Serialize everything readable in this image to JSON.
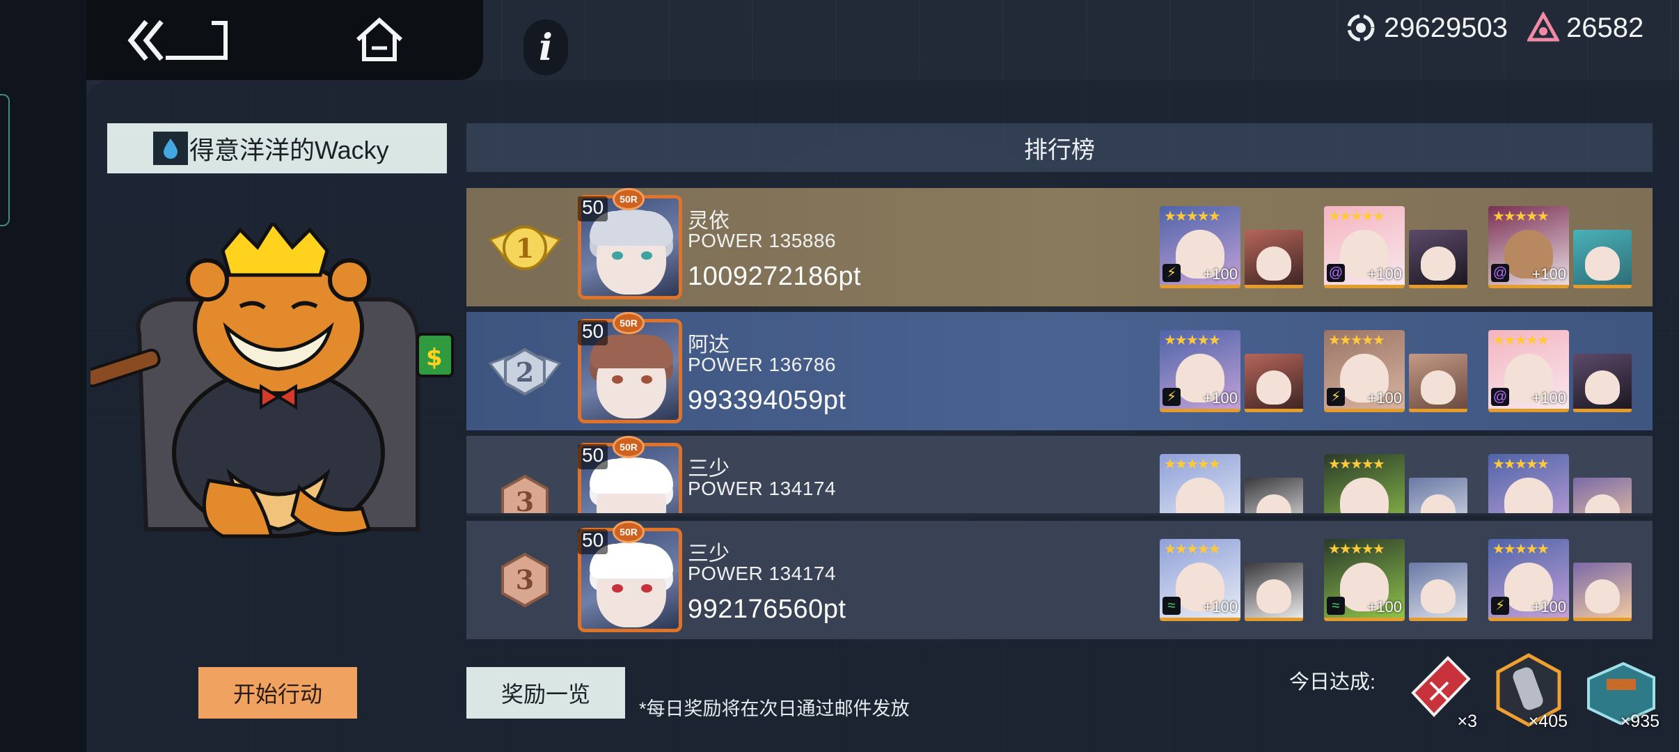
{
  "header": {
    "back_icon": "double-chevron-back-icon",
    "home_icon": "home-icon",
    "info_label": "i",
    "currency_1": "29629503",
    "currency_2": "26582"
  },
  "player": {
    "name": "得意洋洋的Wacky"
  },
  "leaderboard": {
    "title": "排行榜",
    "rows": [
      {
        "rank": "1",
        "level": "50",
        "name": "灵依",
        "power": "POWER 135886",
        "score": "1009272186pt"
      },
      {
        "rank": "2",
        "level": "50",
        "name": "阿达",
        "power": "POWER 136786",
        "score": "993394059pt"
      },
      {
        "rank": "3",
        "level": "50",
        "name": "三少",
        "power": "POWER 134174",
        "score": ""
      },
      {
        "rank": "3",
        "level": "50",
        "name": "三少",
        "power": "POWER 134174",
        "score": "992176560pt"
      }
    ],
    "plus_label": "+100"
  },
  "actions": {
    "start_label": "开始行动",
    "rewards_label": "奖励一览",
    "note": "*每日奖励将在次日通过邮件发放"
  },
  "today": {
    "label": "今日达成:",
    "items": [
      {
        "count": "×3"
      },
      {
        "count": "×405"
      },
      {
        "count": "×935"
      }
    ]
  },
  "colors": {
    "row_gold": "#8a7a5c",
    "row_silver": "#4a6290",
    "row_bronze": "#394254",
    "accent_orange": "#f0a261",
    "frame_orange": "#e0732a"
  }
}
